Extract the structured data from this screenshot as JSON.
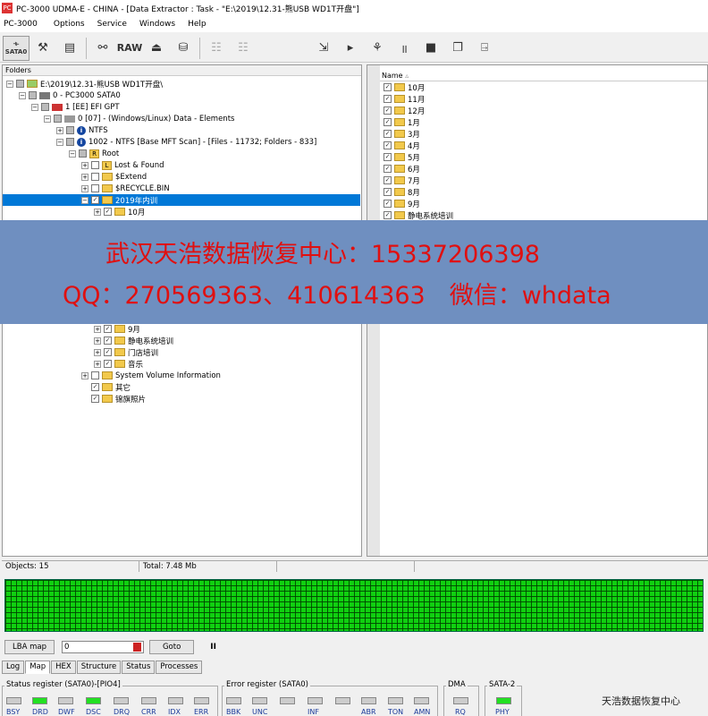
{
  "window": {
    "title": "PC-3000 UDMA-E - CHINA - [Data Extractor : Task - \"E:\\2019\\12.31-熊USB WD1T开盘\"]",
    "app_icon": "app-logo-icon"
  },
  "menu": [
    "PC-3000",
    "Options",
    "Service",
    "Windows",
    "Help"
  ],
  "toolbar": {
    "sata_label": "SATA0",
    "raw_label": "RAW"
  },
  "folders": {
    "header": "Folders",
    "rows": [
      {
        "label": "E:\\2019\\12.31-熊USB WD1T开盘\\",
        "icon": "drive-folder"
      },
      {
        "label": "0 - PC3000 SATA0",
        "icon": "drive"
      },
      {
        "label": "1 [EE] EFI GPT",
        "icon": "disk"
      },
      {
        "label": "0 [07] - (Windows/Linux) Data - Elements",
        "icon": "partition"
      },
      {
        "label": "NTFS",
        "icon": "info"
      },
      {
        "label": "1002 - NTFS [Base MFT Scan] - [Files - 11732; Folders - 833]",
        "icon": "info"
      },
      {
        "label": "Root",
        "icon": "root"
      },
      {
        "label": "Lost & Found",
        "icon": "lost-found"
      },
      {
        "label": "$Extend",
        "icon": "folder"
      },
      {
        "label": "$RECYCLE.BIN",
        "icon": "folder"
      },
      {
        "label": "2019年内训",
        "icon": "folder"
      },
      {
        "label": "10月",
        "icon": "folder"
      },
      {
        "label": "9月",
        "icon": "folder"
      },
      {
        "label": "静电系统培训",
        "icon": "folder"
      },
      {
        "label": "门店培训",
        "icon": "folder"
      },
      {
        "label": "音乐",
        "icon": "folder"
      },
      {
        "label": "System Volume Information",
        "icon": "folder"
      },
      {
        "label": "其它",
        "icon": "folder"
      },
      {
        "label": "锦旗照片",
        "icon": "folder"
      }
    ]
  },
  "files": {
    "header": "Name",
    "items": [
      "10月",
      "11月",
      "12月",
      "1月",
      "3月",
      "4月",
      "5月",
      "6月",
      "7月",
      "8月",
      "9月",
      "静电系统培训"
    ]
  },
  "banner": {
    "line1": "武汉天浩数据恢复中心：15337206398",
    "line2": "QQ：270569363、410614363　微信：whdata"
  },
  "status": {
    "objects": "Objects: 15",
    "total": "Total: 7.48 Mb"
  },
  "lba": {
    "label": "LBA map",
    "value": "0",
    "goto": "Goto",
    "pause": "II"
  },
  "tabs": [
    "Log",
    "Map",
    "HEX",
    "Structure",
    "Status",
    "Processes"
  ],
  "active_tab": "Map",
  "registers": {
    "status_title": "Status register (SATA0)-[PIO4]",
    "status_leds": [
      {
        "name": "BSY",
        "on": false
      },
      {
        "name": "DRD",
        "on": true
      },
      {
        "name": "DWF",
        "on": false
      },
      {
        "name": "DSC",
        "on": true
      },
      {
        "name": "DRQ",
        "on": false
      },
      {
        "name": "CRR",
        "on": false
      },
      {
        "name": "IDX",
        "on": false
      },
      {
        "name": "ERR",
        "on": false
      }
    ],
    "error_title": "Error register (SATA0)",
    "error_leds": [
      {
        "name": "BBK",
        "on": false
      },
      {
        "name": "UNC",
        "on": false
      },
      {
        "name": "",
        "on": false
      },
      {
        "name": "INF",
        "on": false
      },
      {
        "name": "",
        "on": false
      },
      {
        "name": "ABR",
        "on": false
      },
      {
        "name": "TON",
        "on": false
      },
      {
        "name": "AMN",
        "on": false
      }
    ],
    "dma_title": "DMA",
    "dma_led": {
      "name": "RQ",
      "on": false
    },
    "sata_title": "SATA-2",
    "sata_led": {
      "name": "PHY",
      "on": true
    }
  },
  "watermark": "天浩数据恢复中心",
  "colors": {
    "selection": "#0078d7",
    "banner": "#6f8fc0",
    "banner_text": "#e01010",
    "map_green": "#10d010"
  }
}
